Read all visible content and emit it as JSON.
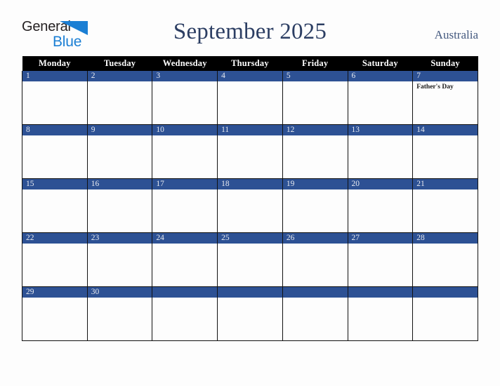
{
  "brand": {
    "name_part1": "General",
    "name_part2": "Blue",
    "logo_icon": "blue-triangle-icon",
    "color_dark": "#231f20",
    "color_blue": "#1b7fd4"
  },
  "header": {
    "title": "September 2025",
    "region": "Australia",
    "title_color": "#2c3e63"
  },
  "calendar": {
    "weekday_headers": [
      "Monday",
      "Tuesday",
      "Wednesday",
      "Thursday",
      "Friday",
      "Saturday",
      "Sunday"
    ],
    "header_bg": "#000000",
    "daybar_bg": "#2d5194",
    "cell_bg": "#fdfdfd",
    "weeks": [
      [
        {
          "date": "1",
          "events": []
        },
        {
          "date": "2",
          "events": []
        },
        {
          "date": "3",
          "events": []
        },
        {
          "date": "4",
          "events": []
        },
        {
          "date": "5",
          "events": []
        },
        {
          "date": "6",
          "events": []
        },
        {
          "date": "7",
          "events": [
            "Father's Day"
          ]
        }
      ],
      [
        {
          "date": "8",
          "events": []
        },
        {
          "date": "9",
          "events": []
        },
        {
          "date": "10",
          "events": []
        },
        {
          "date": "11",
          "events": []
        },
        {
          "date": "12",
          "events": []
        },
        {
          "date": "13",
          "events": []
        },
        {
          "date": "14",
          "events": []
        }
      ],
      [
        {
          "date": "15",
          "events": []
        },
        {
          "date": "16",
          "events": []
        },
        {
          "date": "17",
          "events": []
        },
        {
          "date": "18",
          "events": []
        },
        {
          "date": "19",
          "events": []
        },
        {
          "date": "20",
          "events": []
        },
        {
          "date": "21",
          "events": []
        }
      ],
      [
        {
          "date": "22",
          "events": []
        },
        {
          "date": "23",
          "events": []
        },
        {
          "date": "24",
          "events": []
        },
        {
          "date": "25",
          "events": []
        },
        {
          "date": "26",
          "events": []
        },
        {
          "date": "27",
          "events": []
        },
        {
          "date": "28",
          "events": []
        }
      ],
      [
        {
          "date": "29",
          "events": []
        },
        {
          "date": "30",
          "events": []
        },
        {
          "date": "",
          "events": []
        },
        {
          "date": "",
          "events": []
        },
        {
          "date": "",
          "events": []
        },
        {
          "date": "",
          "events": []
        },
        {
          "date": "",
          "events": []
        }
      ]
    ]
  }
}
